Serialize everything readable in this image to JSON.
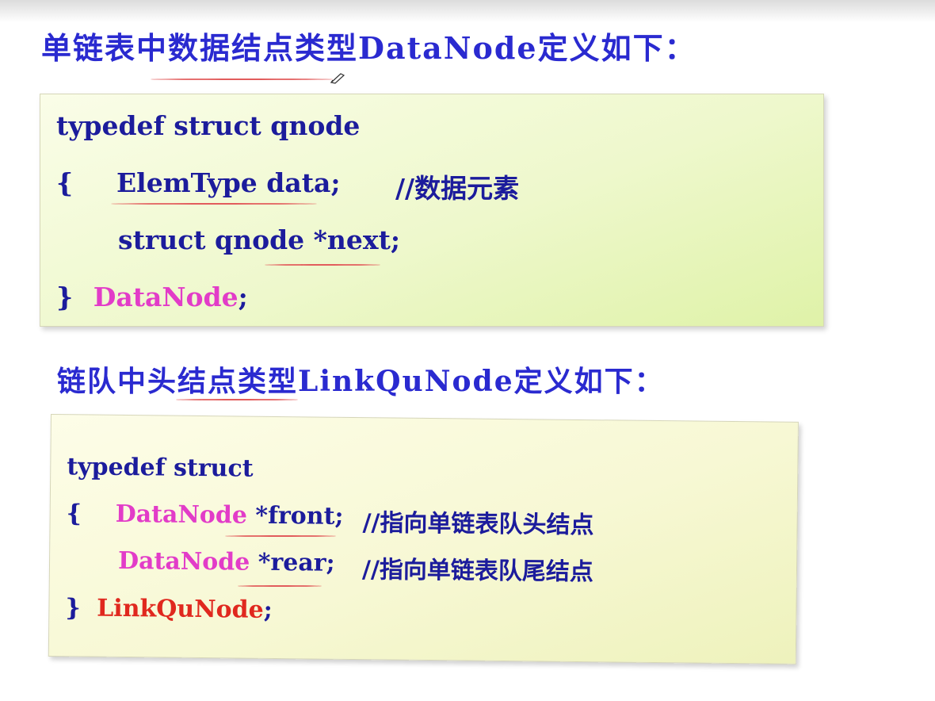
{
  "heading1": "单链表中数据结点类型DataNode定义如下：",
  "box1": {
    "l1": "typedef struct qnode",
    "l2_brace": "{",
    "l2_code": "ElemType data;",
    "l2_comment": "//数据元素",
    "l3_a": "struct qnode ",
    "l3_b": "*next;",
    "l4_brace": "}",
    "l4_name": "DataNode",
    "l4_semi": ";"
  },
  "heading2": "链队中头结点类型LinkQuNode定义如下：",
  "box2": {
    "l1": "typedef struct",
    "l2_brace": "{",
    "l2_type": "DataNode",
    "l2_field": " *front;",
    "l2_comment": "//指向单链表队头结点",
    "l3_type": "DataNode",
    "l3_field": " *rear;",
    "l3_comment": "//指向单链表队尾结点",
    "l4_brace": "}",
    "l4_name": "LinkQuNode",
    "l4_semi": ";"
  },
  "colors": {
    "heading": "#2a2ad0",
    "code": "#1c1c9c",
    "pink": "#e23cc8",
    "red": "#e0281e",
    "annotation": "#e25c5c"
  },
  "icons": [
    "pen-cursor-icon"
  ]
}
